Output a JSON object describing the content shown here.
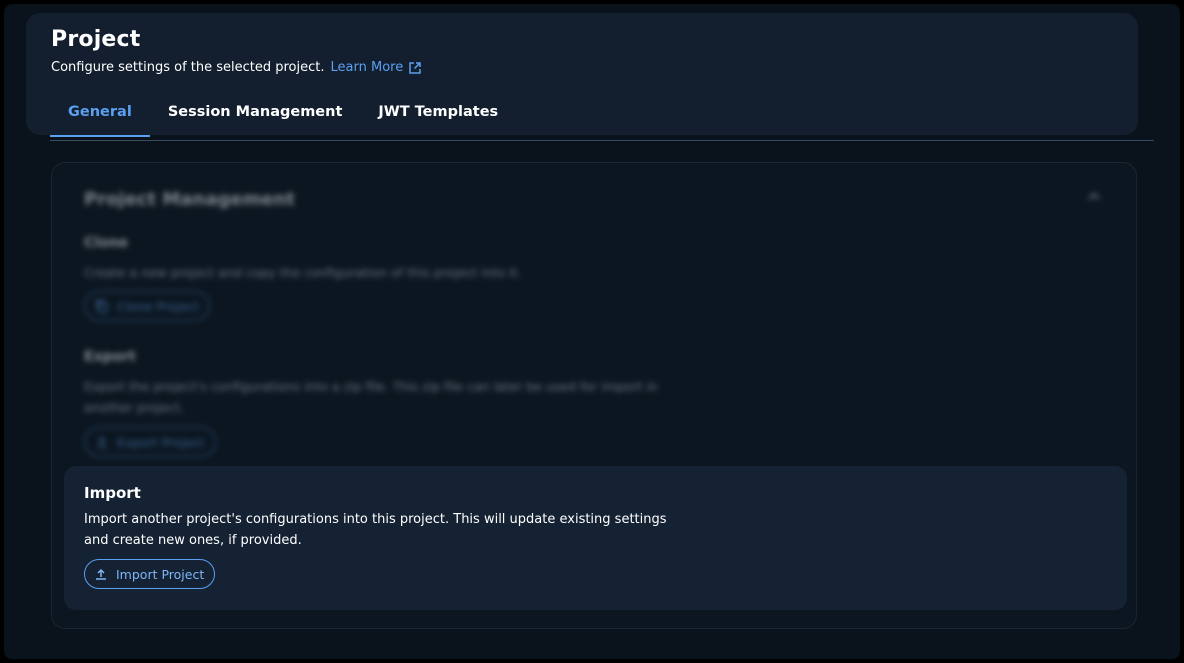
{
  "header": {
    "title": "Project",
    "subtitle": "Configure settings of the selected project.",
    "learn_more": "Learn More"
  },
  "tabs": [
    {
      "label": "General",
      "active": true
    },
    {
      "label": "Session Management",
      "active": false
    },
    {
      "label": "JWT Templates",
      "active": false
    }
  ],
  "project_management": {
    "title": "Project Management",
    "clone": {
      "title": "Clone",
      "description": "Create a new project and copy the configuration of this project into it.",
      "button": "Clone Project"
    },
    "export": {
      "title": "Export",
      "description": "Export the project's configurations into a zip file. This zip file can later be used for import in another project.",
      "button": "Export Project"
    },
    "import": {
      "title": "Import",
      "description": "Import another project's configurations into this project. This will update existing settings and create new ones, if provided.",
      "button": "Import Project"
    }
  },
  "icons": {
    "learn_more": "external-link-icon",
    "collapse": "chevron-up-icon",
    "clone": "copy-icon",
    "export": "upload-icon",
    "import": "upload-icon"
  },
  "colors": {
    "accent": "#5aa0f0",
    "background": "#0a131c",
    "card": "#131f2e",
    "import_card": "#152233"
  }
}
